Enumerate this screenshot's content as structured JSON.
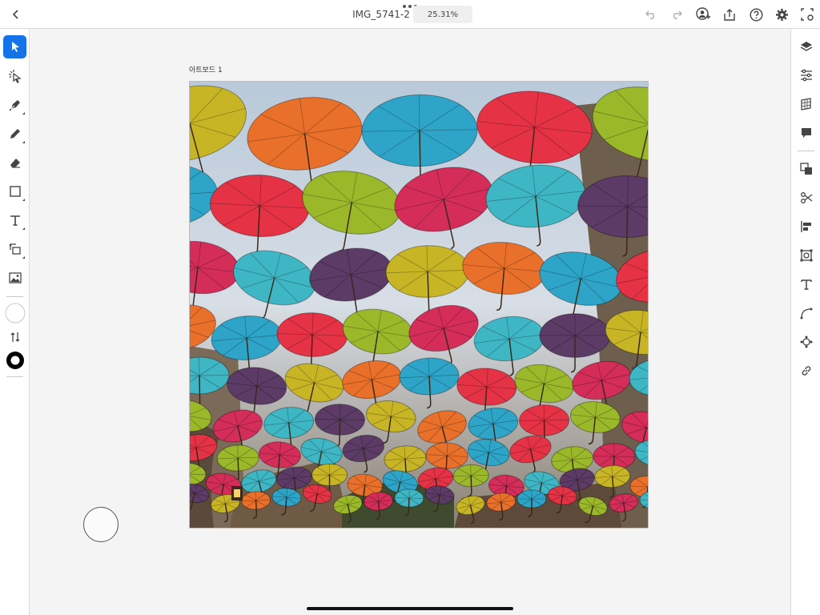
{
  "header": {
    "document_title": "IMG_5741-2",
    "zoom_level": "25.31%"
  },
  "canvas": {
    "artboard_label": "아트보드 1"
  },
  "left_toolbar": {
    "tools": [
      "select-tool",
      "direct-select-tool",
      "pen-tool",
      "pencil-tool",
      "eraser-tool",
      "rectangle-tool",
      "type-tool",
      "transform-tool",
      "place-image-tool"
    ],
    "active_tool": "select-tool",
    "fill_color": "#ffffff",
    "stroke_color": "#000000"
  },
  "right_toolbar": {
    "panels": [
      "layers",
      "properties",
      "libraries",
      "comments",
      "pathfinder",
      "cut-tools",
      "align",
      "transform",
      "type",
      "curvature",
      "symbol",
      "links"
    ]
  },
  "colors": {
    "accent": "#1473e6",
    "umbrella_palette": [
      "#c8b526",
      "#d42d5a",
      "#2ea5c8",
      "#5c3b66",
      "#9ab82a",
      "#e9702a",
      "#3fb6c4",
      "#e53345"
    ]
  },
  "photo": {
    "subject": ""
  }
}
